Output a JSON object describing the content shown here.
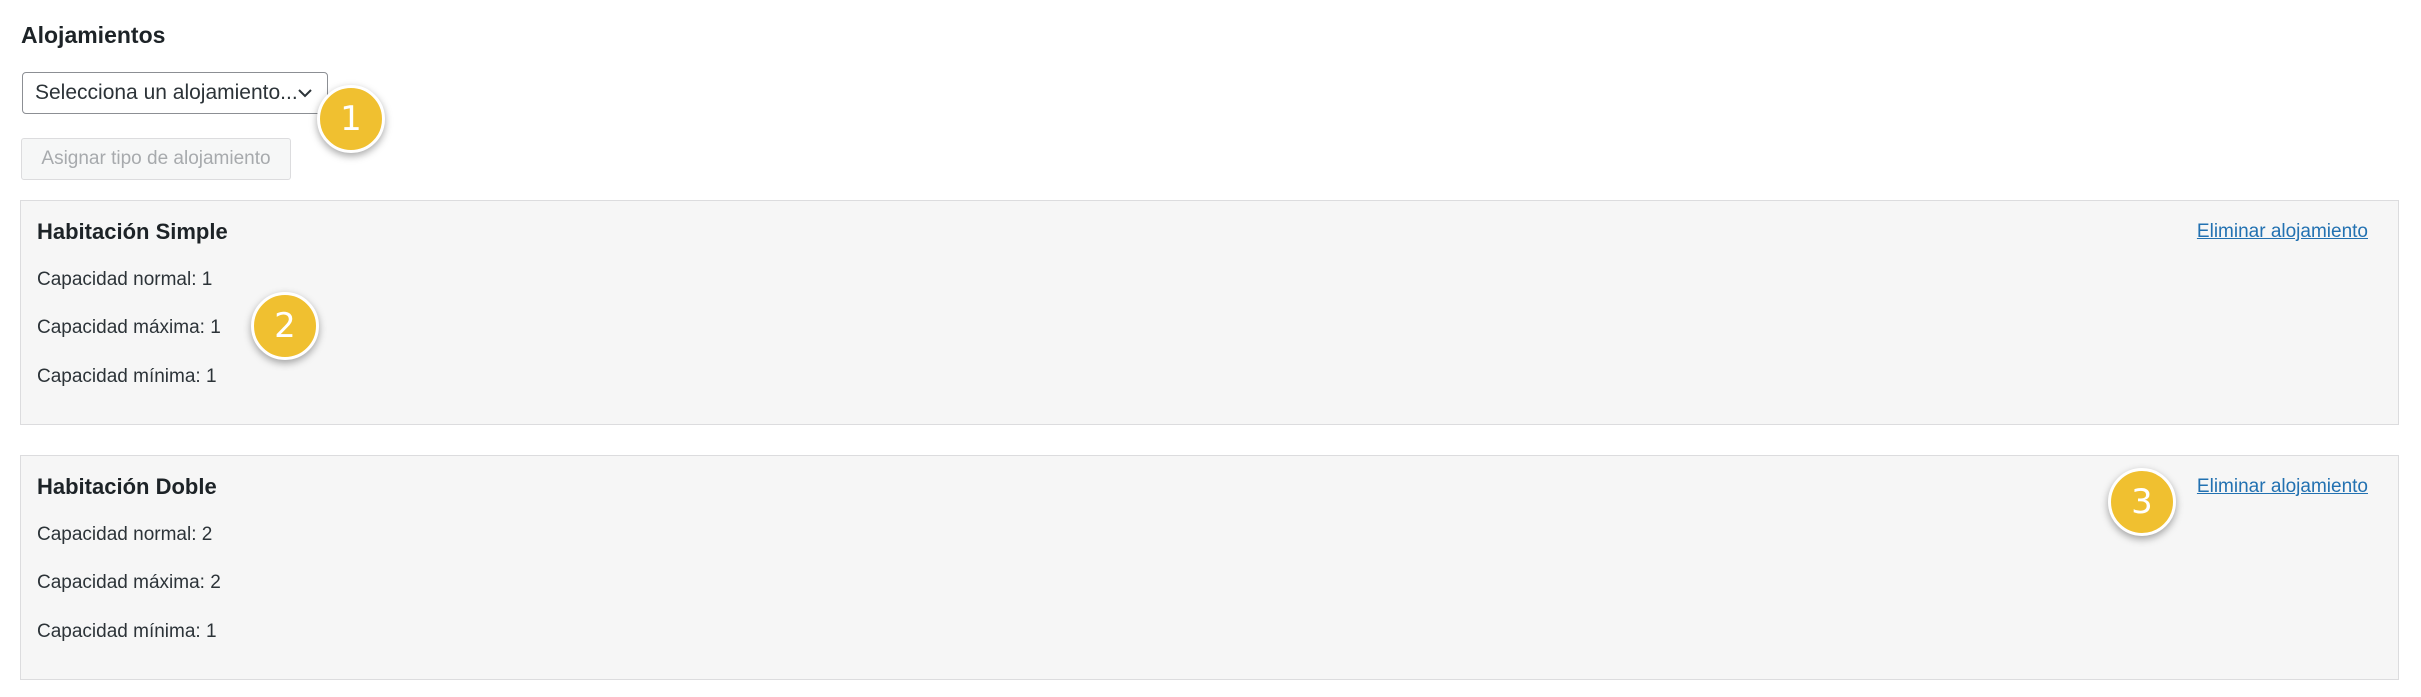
{
  "section": {
    "title": "Alojamientos"
  },
  "select": {
    "value": "Selecciona un alojamiento..."
  },
  "assign_button": {
    "label": "Asignar tipo de alojamiento"
  },
  "accommodations": [
    {
      "title": "Habitación Simple",
      "normal": "Capacidad normal: 1",
      "max": "Capacidad máxima: 1",
      "min": "Capacidad mínima: 1",
      "delete_label": "Eliminar alojamiento"
    },
    {
      "title": "Habitación Doble",
      "normal": "Capacidad normal: 2",
      "max": "Capacidad máxima: 2",
      "min": "Capacidad mínima: 1",
      "delete_label": "Eliminar alojamiento"
    }
  ],
  "markers": [
    "1",
    "2",
    "3"
  ],
  "colors": {
    "accent_link": "#2271b1",
    "marker": "#f0c030",
    "card_bg": "#f6f6f6"
  }
}
